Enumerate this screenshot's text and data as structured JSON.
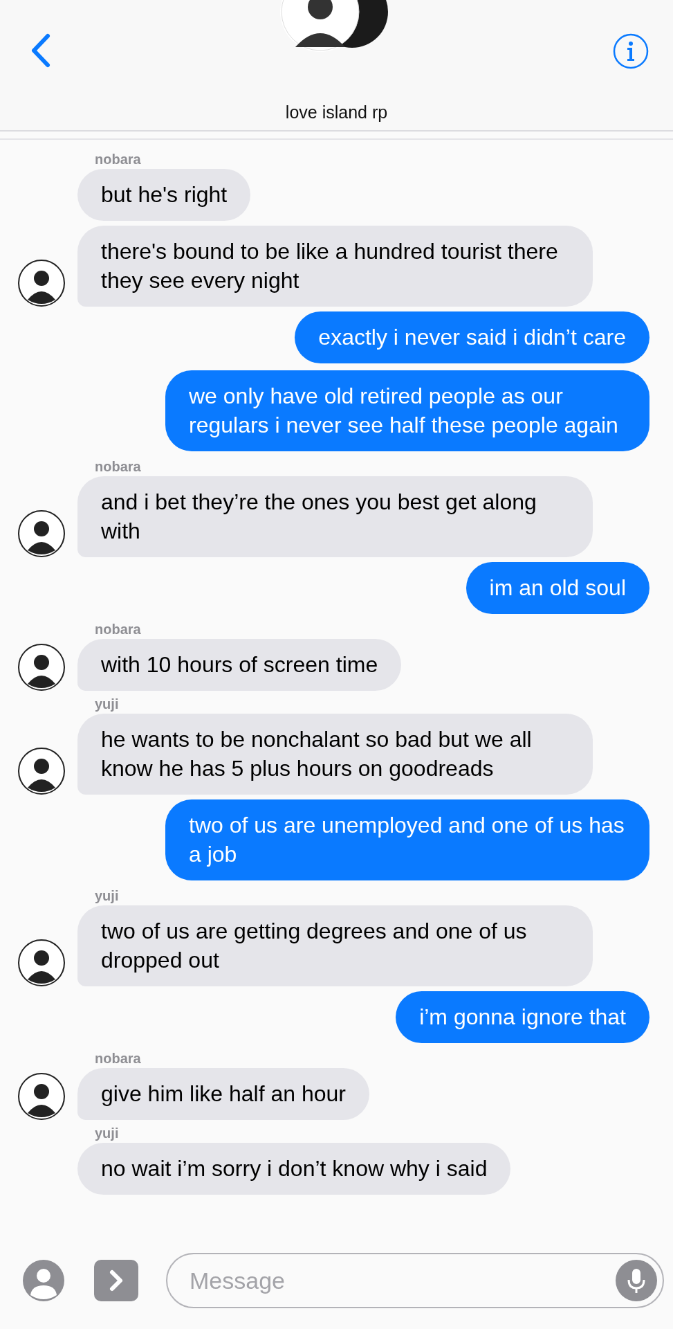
{
  "header": {
    "title": "love island rp"
  },
  "messages": [
    {
      "kind": "name",
      "text": "nobara"
    },
    {
      "kind": "incoming",
      "text": "but he's right",
      "avatar": false
    },
    {
      "kind": "incoming",
      "text": "there's bound to be like a hundred tourist there they see every night",
      "avatar": true
    },
    {
      "kind": "outgoing",
      "text": "exactly i never said i didn’t care"
    },
    {
      "kind": "outgoing",
      "text": "we only have old retired people as our regulars i never see half these people again"
    },
    {
      "kind": "name",
      "text": "nobara"
    },
    {
      "kind": "incoming",
      "text": "and i bet they’re the ones you best get along with",
      "avatar": true
    },
    {
      "kind": "outgoing",
      "text": "im an old soul"
    },
    {
      "kind": "name",
      "text": "nobara"
    },
    {
      "kind": "incoming",
      "text": "with 10 hours of screen time",
      "avatar": true
    },
    {
      "kind": "name",
      "text": "yuji"
    },
    {
      "kind": "incoming",
      "text": "he wants to be nonchalant so bad but we all know he has 5 plus hours on goodreads",
      "avatar": true
    },
    {
      "kind": "outgoing",
      "text": "two of us are unemployed and one of us has a job"
    },
    {
      "kind": "name",
      "text": "yuji"
    },
    {
      "kind": "incoming",
      "text": "two of us are getting degrees and one of us dropped out",
      "avatar": true
    },
    {
      "kind": "outgoing",
      "text": "i’m gonna ignore that"
    },
    {
      "kind": "name",
      "text": "nobara"
    },
    {
      "kind": "incoming",
      "text": "give him like half an hour",
      "avatar": true
    },
    {
      "kind": "name",
      "text": "yuji"
    },
    {
      "kind": "incoming",
      "text": "no wait i’m sorry i don’t know why i said",
      "avatar": false
    }
  ],
  "composer": {
    "placeholder": "Message"
  }
}
